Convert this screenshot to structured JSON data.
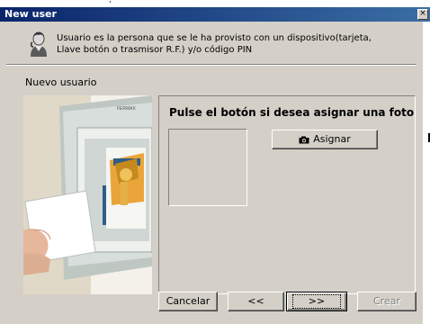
{
  "window": {
    "title": "New user",
    "close_glyph": "×"
  },
  "header": {
    "icon": "user-icon",
    "line1": "Usuario es la persona que se le ha provisto con un dispositivo(tarjeta,",
    "line2": "Llave botón o trasmisor R.F.) y/o código PIN"
  },
  "section": {
    "title": "Nuevo usuario"
  },
  "photo_illustration": {
    "brand": "FERMAX"
  },
  "panel": {
    "title": "Pulse el botón si desea asignar una foto",
    "assign_button": "Asignar",
    "assign_icon": "camera-icon"
  },
  "buttons": {
    "cancel": "Cancelar",
    "prev": "<<",
    "next": ">>",
    "create": "Crear"
  },
  "colors": {
    "titlebar_start": "#0a246a",
    "titlebar_end": "#3a6ea5",
    "dialog_bg": "#d4d0c8"
  }
}
